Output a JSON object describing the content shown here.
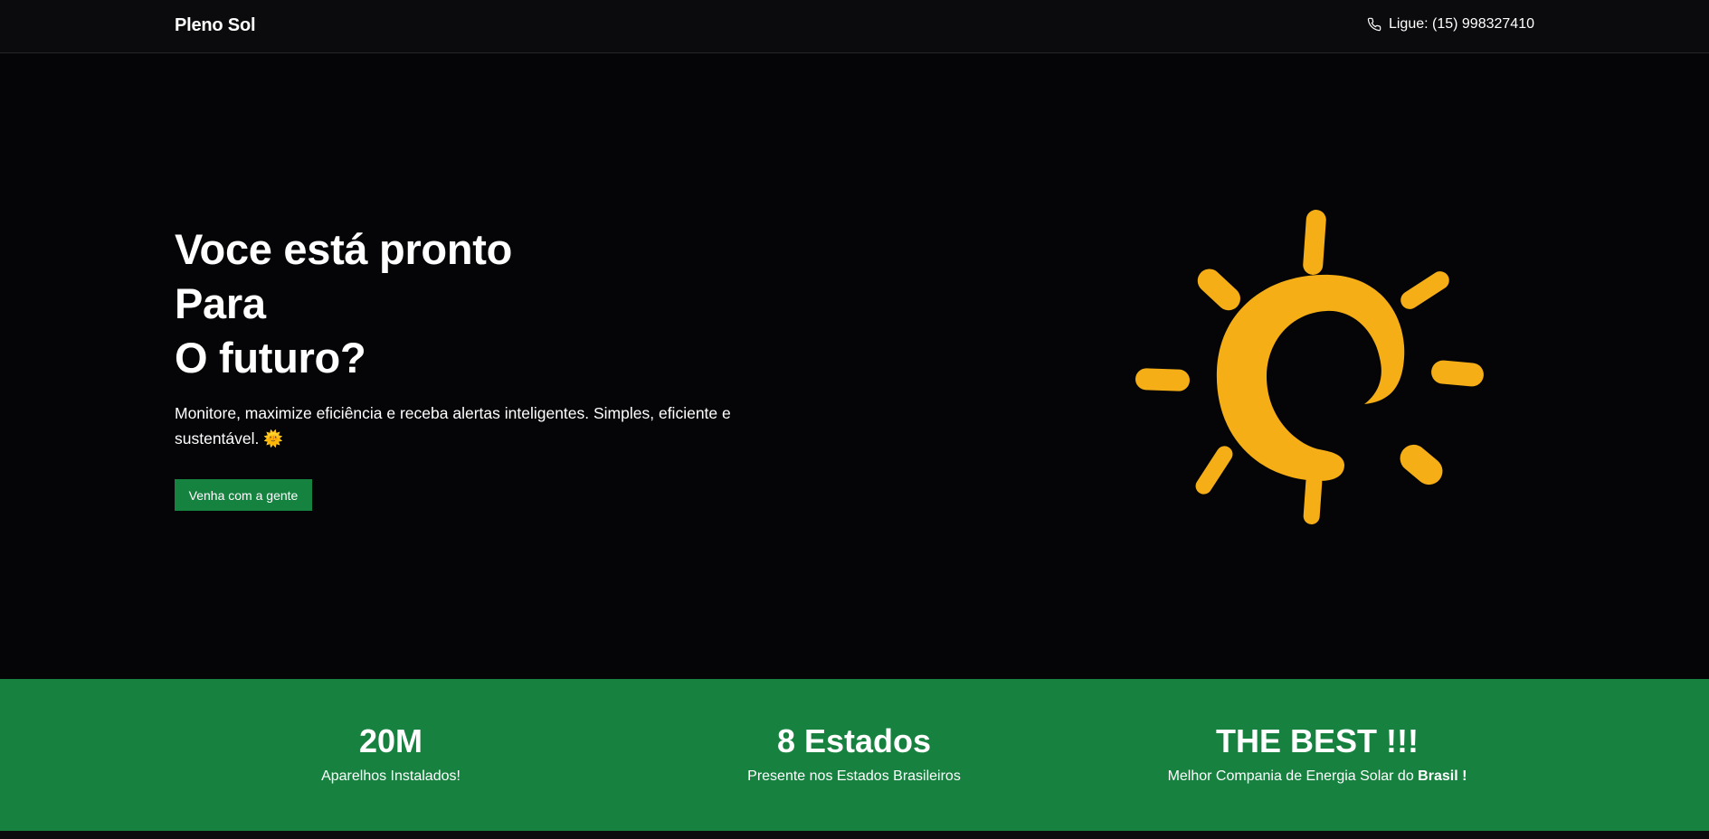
{
  "header": {
    "brand": "Pleno Sol",
    "contact_icon": "phone-icon",
    "contact_text": "Ligue: (15) 998327410"
  },
  "hero": {
    "title_lines": [
      "Voce está pronto",
      "Para",
      "O futuro?"
    ],
    "description": "Monitore, maximize eficiência e receba alertas inteligentes. Simples, eficiente e sustentável. 🌞",
    "cta_label": "Venha com a gente",
    "illustration": "sun-icon"
  },
  "stats": [
    {
      "value": "20M",
      "label": "Aparelhos Instalados!"
    },
    {
      "value": "8 Estados",
      "label": "Presente nos Estados Brasileiros"
    },
    {
      "value": "THE BEST !!!",
      "label": "Melhor Compania de Energia Solar do",
      "label_bold": "Brasil !"
    }
  ],
  "colors": {
    "background": "#000000",
    "header_background": "#0b0b0d",
    "accent_green": "#178240",
    "sun_yellow": "#F5AE16",
    "text": "#ffffff"
  }
}
